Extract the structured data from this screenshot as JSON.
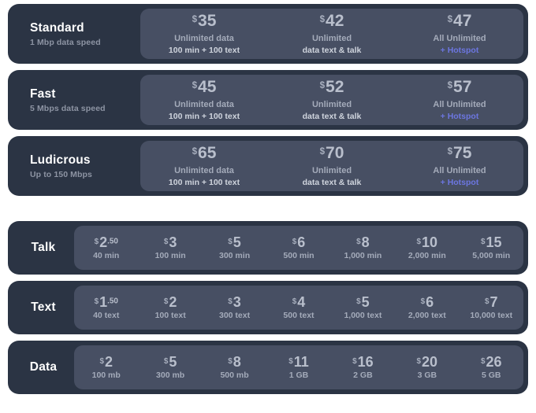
{
  "theme": {
    "background": "#ffffff",
    "card_bg": "#2b3444",
    "panel_bg": "#474f63",
    "price_color": "#b9bfcc",
    "muted_text": "#a4abba",
    "bright_text": "#ffffff",
    "accent": "#6c76e0"
  },
  "plans": [
    {
      "name": "Standard",
      "speed": "1 Mbp data speed",
      "options": [
        {
          "currency": "$",
          "amount": "35",
          "cents": "",
          "line1": "Unlimited data",
          "line2": "100 min + 100 text",
          "accent": false
        },
        {
          "currency": "$",
          "amount": "42",
          "cents": "",
          "line1": "Unlimited",
          "line2": "data text & talk",
          "accent": false
        },
        {
          "currency": "$",
          "amount": "47",
          "cents": "",
          "line1": "All Unlimited",
          "line2": "+ Hotspot",
          "accent": true
        }
      ]
    },
    {
      "name": "Fast",
      "speed": "5 Mbps data speed",
      "options": [
        {
          "currency": "$",
          "amount": "45",
          "cents": "",
          "line1": "Unlimited data",
          "line2": "100 min + 100 text",
          "accent": false
        },
        {
          "currency": "$",
          "amount": "52",
          "cents": "",
          "line1": "Unlimited",
          "line2": "data text & talk",
          "accent": false
        },
        {
          "currency": "$",
          "amount": "57",
          "cents": "",
          "line1": "All Unlimited",
          "line2": "+ Hotspot",
          "accent": true
        }
      ]
    },
    {
      "name": "Ludicrous",
      "speed": "Up to 150 Mbps",
      "options": [
        {
          "currency": "$",
          "amount": "65",
          "cents": "",
          "line1": "Unlimited data",
          "line2": "100 min + 100 text",
          "accent": false
        },
        {
          "currency": "$",
          "amount": "70",
          "cents": "",
          "line1": "Unlimited",
          "line2": "data text & talk",
          "accent": false
        },
        {
          "currency": "$",
          "amount": "75",
          "cents": "",
          "line1": "All Unlimited",
          "line2": "+ Hotspot",
          "accent": true
        }
      ]
    }
  ],
  "addons": [
    {
      "name": "Talk",
      "options": [
        {
          "currency": "$",
          "amount": "2",
          "cents": ".50",
          "sub": "40 min"
        },
        {
          "currency": "$",
          "amount": "3",
          "cents": "",
          "sub": "100 min"
        },
        {
          "currency": "$",
          "amount": "5",
          "cents": "",
          "sub": "300 min"
        },
        {
          "currency": "$",
          "amount": "6",
          "cents": "",
          "sub": "500 min"
        },
        {
          "currency": "$",
          "amount": "8",
          "cents": "",
          "sub": "1,000 min"
        },
        {
          "currency": "$",
          "amount": "10",
          "cents": "",
          "sub": "2,000 min"
        },
        {
          "currency": "$",
          "amount": "15",
          "cents": "",
          "sub": "5,000 min"
        }
      ]
    },
    {
      "name": "Text",
      "options": [
        {
          "currency": "$",
          "amount": "1",
          "cents": ".50",
          "sub": "40 text"
        },
        {
          "currency": "$",
          "amount": "2",
          "cents": "",
          "sub": "100 text"
        },
        {
          "currency": "$",
          "amount": "3",
          "cents": "",
          "sub": "300 text"
        },
        {
          "currency": "$",
          "amount": "4",
          "cents": "",
          "sub": "500 text"
        },
        {
          "currency": "$",
          "amount": "5",
          "cents": "",
          "sub": "1,000 text"
        },
        {
          "currency": "$",
          "amount": "6",
          "cents": "",
          "sub": "2,000 text"
        },
        {
          "currency": "$",
          "amount": "7",
          "cents": "",
          "sub": "10,000 text"
        }
      ]
    },
    {
      "name": "Data",
      "options": [
        {
          "currency": "$",
          "amount": "2",
          "cents": "",
          "sub": "100 mb"
        },
        {
          "currency": "$",
          "amount": "5",
          "cents": "",
          "sub": "300 mb"
        },
        {
          "currency": "$",
          "amount": "8",
          "cents": "",
          "sub": "500 mb"
        },
        {
          "currency": "$",
          "amount": "11",
          "cents": "",
          "sub": "1 GB"
        },
        {
          "currency": "$",
          "amount": "16",
          "cents": "",
          "sub": "2 GB"
        },
        {
          "currency": "$",
          "amount": "20",
          "cents": "",
          "sub": "3 GB"
        },
        {
          "currency": "$",
          "amount": "26",
          "cents": "",
          "sub": "5 GB"
        }
      ]
    }
  ]
}
